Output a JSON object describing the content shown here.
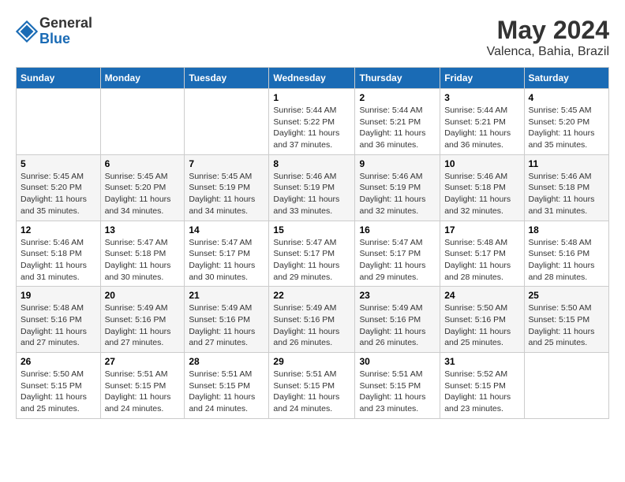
{
  "header": {
    "logo_general": "General",
    "logo_blue": "Blue",
    "month_year": "May 2024",
    "location": "Valenca, Bahia, Brazil"
  },
  "weekdays": [
    "Sunday",
    "Monday",
    "Tuesday",
    "Wednesday",
    "Thursday",
    "Friday",
    "Saturday"
  ],
  "weeks": [
    [
      {
        "day": "",
        "sunrise": "",
        "sunset": "",
        "daylight": ""
      },
      {
        "day": "",
        "sunrise": "",
        "sunset": "",
        "daylight": ""
      },
      {
        "day": "",
        "sunrise": "",
        "sunset": "",
        "daylight": ""
      },
      {
        "day": "1",
        "sunrise": "Sunrise: 5:44 AM",
        "sunset": "Sunset: 5:22 PM",
        "daylight": "Daylight: 11 hours and 37 minutes."
      },
      {
        "day": "2",
        "sunrise": "Sunrise: 5:44 AM",
        "sunset": "Sunset: 5:21 PM",
        "daylight": "Daylight: 11 hours and 36 minutes."
      },
      {
        "day": "3",
        "sunrise": "Sunrise: 5:44 AM",
        "sunset": "Sunset: 5:21 PM",
        "daylight": "Daylight: 11 hours and 36 minutes."
      },
      {
        "day": "4",
        "sunrise": "Sunrise: 5:45 AM",
        "sunset": "Sunset: 5:20 PM",
        "daylight": "Daylight: 11 hours and 35 minutes."
      }
    ],
    [
      {
        "day": "5",
        "sunrise": "Sunrise: 5:45 AM",
        "sunset": "Sunset: 5:20 PM",
        "daylight": "Daylight: 11 hours and 35 minutes."
      },
      {
        "day": "6",
        "sunrise": "Sunrise: 5:45 AM",
        "sunset": "Sunset: 5:20 PM",
        "daylight": "Daylight: 11 hours and 34 minutes."
      },
      {
        "day": "7",
        "sunrise": "Sunrise: 5:45 AM",
        "sunset": "Sunset: 5:19 PM",
        "daylight": "Daylight: 11 hours and 34 minutes."
      },
      {
        "day": "8",
        "sunrise": "Sunrise: 5:46 AM",
        "sunset": "Sunset: 5:19 PM",
        "daylight": "Daylight: 11 hours and 33 minutes."
      },
      {
        "day": "9",
        "sunrise": "Sunrise: 5:46 AM",
        "sunset": "Sunset: 5:19 PM",
        "daylight": "Daylight: 11 hours and 32 minutes."
      },
      {
        "day": "10",
        "sunrise": "Sunrise: 5:46 AM",
        "sunset": "Sunset: 5:18 PM",
        "daylight": "Daylight: 11 hours and 32 minutes."
      },
      {
        "day": "11",
        "sunrise": "Sunrise: 5:46 AM",
        "sunset": "Sunset: 5:18 PM",
        "daylight": "Daylight: 11 hours and 31 minutes."
      }
    ],
    [
      {
        "day": "12",
        "sunrise": "Sunrise: 5:46 AM",
        "sunset": "Sunset: 5:18 PM",
        "daylight": "Daylight: 11 hours and 31 minutes."
      },
      {
        "day": "13",
        "sunrise": "Sunrise: 5:47 AM",
        "sunset": "Sunset: 5:18 PM",
        "daylight": "Daylight: 11 hours and 30 minutes."
      },
      {
        "day": "14",
        "sunrise": "Sunrise: 5:47 AM",
        "sunset": "Sunset: 5:17 PM",
        "daylight": "Daylight: 11 hours and 30 minutes."
      },
      {
        "day": "15",
        "sunrise": "Sunrise: 5:47 AM",
        "sunset": "Sunset: 5:17 PM",
        "daylight": "Daylight: 11 hours and 29 minutes."
      },
      {
        "day": "16",
        "sunrise": "Sunrise: 5:47 AM",
        "sunset": "Sunset: 5:17 PM",
        "daylight": "Daylight: 11 hours and 29 minutes."
      },
      {
        "day": "17",
        "sunrise": "Sunrise: 5:48 AM",
        "sunset": "Sunset: 5:17 PM",
        "daylight": "Daylight: 11 hours and 28 minutes."
      },
      {
        "day": "18",
        "sunrise": "Sunrise: 5:48 AM",
        "sunset": "Sunset: 5:16 PM",
        "daylight": "Daylight: 11 hours and 28 minutes."
      }
    ],
    [
      {
        "day": "19",
        "sunrise": "Sunrise: 5:48 AM",
        "sunset": "Sunset: 5:16 PM",
        "daylight": "Daylight: 11 hours and 27 minutes."
      },
      {
        "day": "20",
        "sunrise": "Sunrise: 5:49 AM",
        "sunset": "Sunset: 5:16 PM",
        "daylight": "Daylight: 11 hours and 27 minutes."
      },
      {
        "day": "21",
        "sunrise": "Sunrise: 5:49 AM",
        "sunset": "Sunset: 5:16 PM",
        "daylight": "Daylight: 11 hours and 27 minutes."
      },
      {
        "day": "22",
        "sunrise": "Sunrise: 5:49 AM",
        "sunset": "Sunset: 5:16 PM",
        "daylight": "Daylight: 11 hours and 26 minutes."
      },
      {
        "day": "23",
        "sunrise": "Sunrise: 5:49 AM",
        "sunset": "Sunset: 5:16 PM",
        "daylight": "Daylight: 11 hours and 26 minutes."
      },
      {
        "day": "24",
        "sunrise": "Sunrise: 5:50 AM",
        "sunset": "Sunset: 5:16 PM",
        "daylight": "Daylight: 11 hours and 25 minutes."
      },
      {
        "day": "25",
        "sunrise": "Sunrise: 5:50 AM",
        "sunset": "Sunset: 5:15 PM",
        "daylight": "Daylight: 11 hours and 25 minutes."
      }
    ],
    [
      {
        "day": "26",
        "sunrise": "Sunrise: 5:50 AM",
        "sunset": "Sunset: 5:15 PM",
        "daylight": "Daylight: 11 hours and 25 minutes."
      },
      {
        "day": "27",
        "sunrise": "Sunrise: 5:51 AM",
        "sunset": "Sunset: 5:15 PM",
        "daylight": "Daylight: 11 hours and 24 minutes."
      },
      {
        "day": "28",
        "sunrise": "Sunrise: 5:51 AM",
        "sunset": "Sunset: 5:15 PM",
        "daylight": "Daylight: 11 hours and 24 minutes."
      },
      {
        "day": "29",
        "sunrise": "Sunrise: 5:51 AM",
        "sunset": "Sunset: 5:15 PM",
        "daylight": "Daylight: 11 hours and 24 minutes."
      },
      {
        "day": "30",
        "sunrise": "Sunrise: 5:51 AM",
        "sunset": "Sunset: 5:15 PM",
        "daylight": "Daylight: 11 hours and 23 minutes."
      },
      {
        "day": "31",
        "sunrise": "Sunrise: 5:52 AM",
        "sunset": "Sunset: 5:15 PM",
        "daylight": "Daylight: 11 hours and 23 minutes."
      },
      {
        "day": "",
        "sunrise": "",
        "sunset": "",
        "daylight": ""
      }
    ]
  ]
}
